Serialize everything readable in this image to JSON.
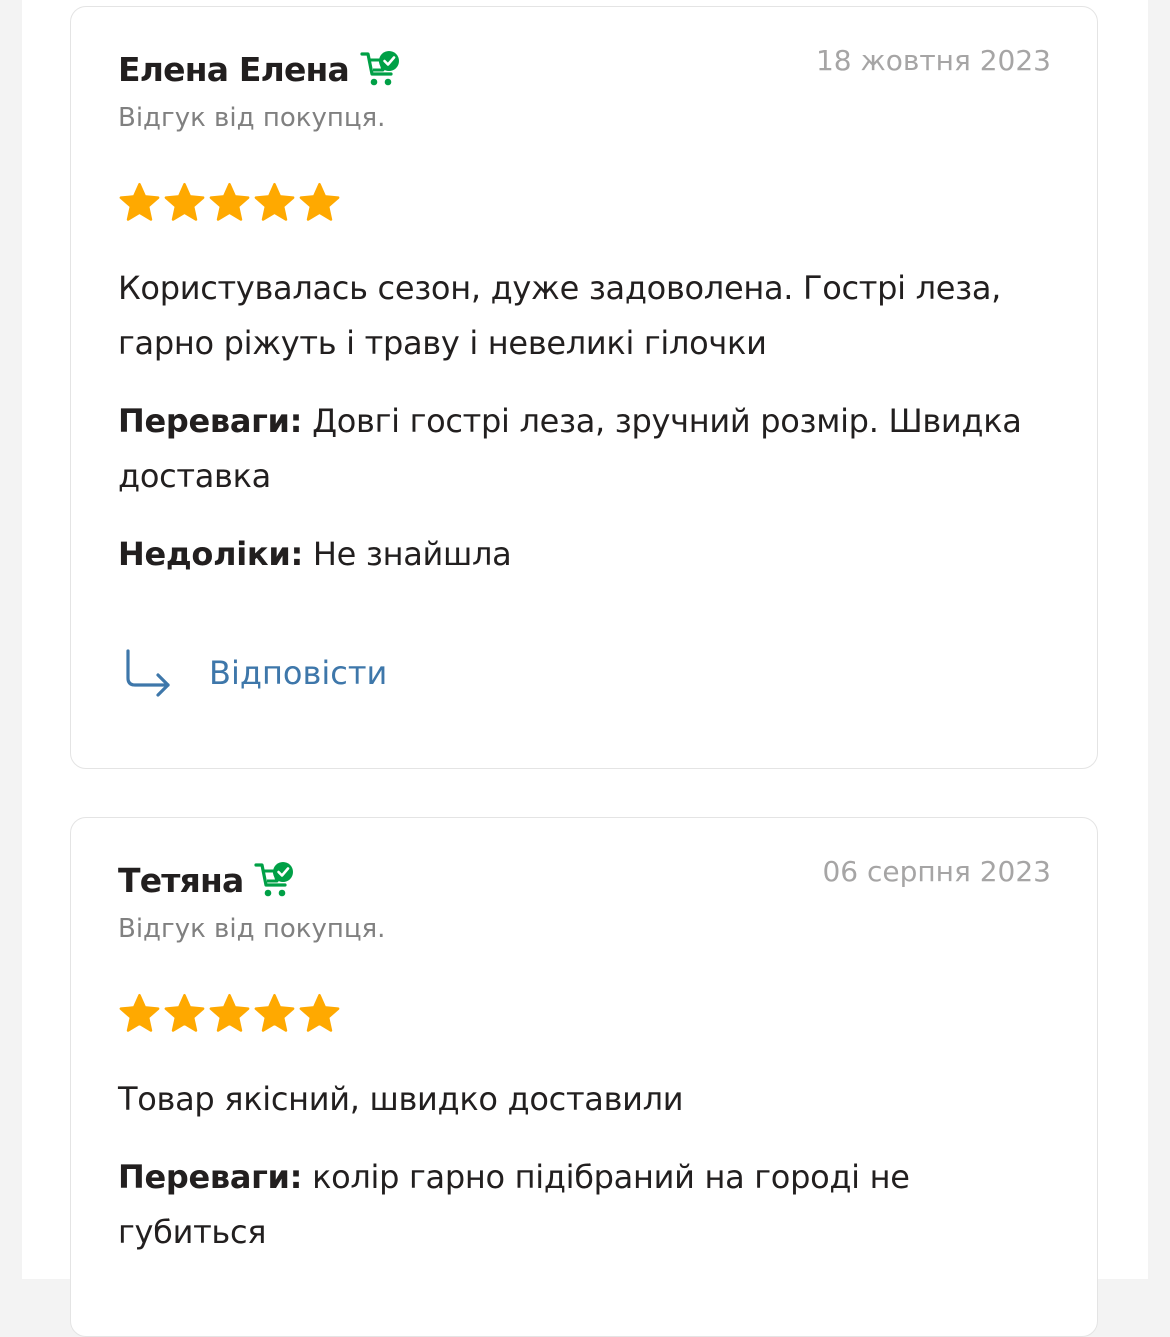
{
  "colors": {
    "accent_link": "#3e77aa",
    "star": "#ffa900",
    "buyer_badge": "#00a046",
    "date": "#a6a5a5"
  },
  "reviews": [
    {
      "author": "Елена Елена",
      "buyer_icon": "cart-check-icon",
      "date": "18 жовтня 2023",
      "type_label": "Відгук від покупця.",
      "rating": 5,
      "text": "Користувалась сезон, дуже задоволена. Гострі леза, гарно ріжуть і траву і невеликі гілочки",
      "pros_label": "Переваги:",
      "pros": "Довгі гострі леза, зручний розмір. Швидка доставка",
      "cons_label": "Недоліки:",
      "cons": "Не знайшла",
      "reply_icon": "reply-arrow-icon",
      "reply_label": "Відповісти"
    },
    {
      "author": "Тетяна",
      "buyer_icon": "cart-check-icon",
      "date": "06 серпня 2023",
      "type_label": "Відгук від покупця.",
      "rating": 5,
      "text": "Товар якісний, швидко доставили",
      "pros_label": "Переваги:",
      "pros": "колір гарно підібраний на городі не губиться"
    }
  ]
}
